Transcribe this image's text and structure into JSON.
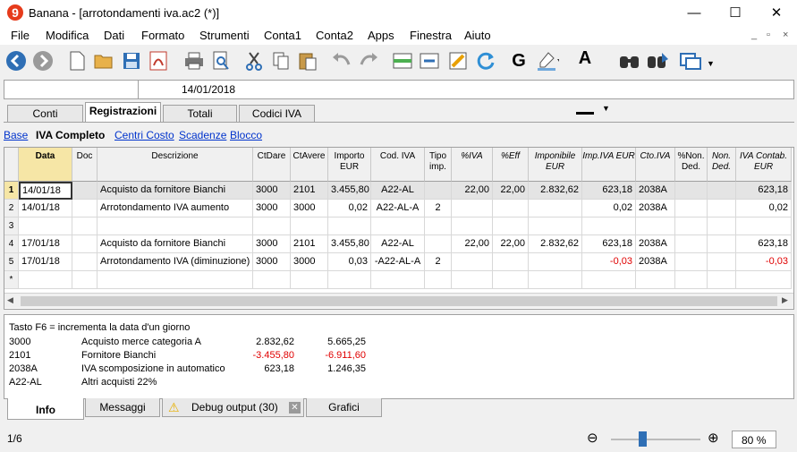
{
  "window": {
    "title": "Banana - [arrotondamenti iva.ac2 (*)]",
    "app_icon": "9",
    "minimize": "—",
    "maximize": "☐",
    "close": "✕"
  },
  "menu": [
    "File",
    "Modifica",
    "Dati",
    "Formato",
    "Strumenti",
    "Conta1",
    "Conta2",
    "Apps",
    "Finestra",
    "Aiuto"
  ],
  "mdi_controls": [
    "_",
    "▫",
    "×"
  ],
  "toolbar": {
    "icons": [
      "back-icon",
      "forward-icon",
      "new-file-icon",
      "open-folder-icon",
      "save-icon",
      "pdf-icon",
      "print-icon",
      "print-preview-icon",
      "cut-icon",
      "copy-icon",
      "paste-icon",
      "undo-icon",
      "redo-icon",
      "insert-rows-icon",
      "delete-rows-icon",
      "edit-icon",
      "recalculate-icon",
      "bold-icon",
      "highlight-icon",
      "font-color-icon",
      "find-icon",
      "find-next-icon",
      "window-icon"
    ],
    "bold_label": "G",
    "font_color_label": "A"
  },
  "cellbar": {
    "value": "14/01/2018"
  },
  "tabs": [
    "Conti",
    "Registrazioni",
    "Totali",
    "Codici IVA"
  ],
  "active_tab": "Registrazioni",
  "views": [
    "Base",
    "IVA Completo",
    "Centri Costo",
    "Scadenze",
    "Blocco"
  ],
  "active_view": "IVA Completo",
  "columns": [
    {
      "label": "Data"
    },
    {
      "label": "Doc"
    },
    {
      "label": "Descrizione"
    },
    {
      "label": "CtDare"
    },
    {
      "label": "CtAvere"
    },
    {
      "label": "Importo EUR"
    },
    {
      "label": "Cod. IVA"
    },
    {
      "label": "Tipo imp."
    },
    {
      "label": "%IVA"
    },
    {
      "label": "%Eff"
    },
    {
      "label": "Imponibile EUR"
    },
    {
      "label": "Imp.IVA EUR"
    },
    {
      "label": "Cto.IVA"
    },
    {
      "label": "%Non. Ded."
    },
    {
      "label": "Non. Ded."
    },
    {
      "label": "IVA Contab. EUR"
    }
  ],
  "rows": [
    {
      "n": "1",
      "data": "14/01/18",
      "doc": "",
      "desc": "Acquisto da fornitore Bianchi",
      "dare": "3000",
      "avere": "2101",
      "importo": "3.455,80",
      "codiva": "A22-AL",
      "tipo": "",
      "iva": "22,00",
      "eff": "22,00",
      "imponibile": "2.832,62",
      "impiva": "623,18",
      "ctoiva": "2038A",
      "pnd": "",
      "nd": "",
      "contab": "623,18"
    },
    {
      "n": "2",
      "data": "14/01/18",
      "doc": "",
      "desc": "Arrotondamento IVA aumento",
      "dare": "3000",
      "avere": "3000",
      "importo": "0,02",
      "codiva": "A22-AL-A",
      "tipo": "2",
      "iva": "",
      "eff": "",
      "imponibile": "",
      "impiva": "0,02",
      "ctoiva": "2038A",
      "pnd": "",
      "nd": "",
      "contab": "0,02"
    },
    {
      "n": "3",
      "data": "",
      "doc": "",
      "desc": "",
      "dare": "",
      "avere": "",
      "importo": "",
      "codiva": "",
      "tipo": "",
      "iva": "",
      "eff": "",
      "imponibile": "",
      "impiva": "",
      "ctoiva": "",
      "pnd": "",
      "nd": "",
      "contab": ""
    },
    {
      "n": "4",
      "data": "17/01/18",
      "doc": "",
      "desc": "Acquisto da fornitore Bianchi",
      "dare": "3000",
      "avere": "2101",
      "importo": "3.455,80",
      "codiva": "A22-AL",
      "tipo": "",
      "iva": "22,00",
      "eff": "22,00",
      "imponibile": "2.832,62",
      "impiva": "623,18",
      "ctoiva": "2038A",
      "pnd": "",
      "nd": "",
      "contab": "623,18"
    },
    {
      "n": "5",
      "data": "17/01/18",
      "doc": "",
      "desc": "Arrotondamento IVA (diminuzione)",
      "dare": "3000",
      "avere": "3000",
      "importo": "0,03",
      "codiva": "-A22-AL-A",
      "tipo": "2",
      "iva": "",
      "eff": "",
      "imponibile": "",
      "impiva": "-0,03",
      "ctoiva": "2038A",
      "pnd": "",
      "nd": "",
      "contab": "-0,03"
    },
    {
      "n": "*",
      "data": "",
      "doc": "",
      "desc": "",
      "dare": "",
      "avere": "",
      "importo": "",
      "codiva": "",
      "tipo": "",
      "iva": "",
      "eff": "",
      "imponibile": "",
      "impiva": "",
      "ctoiva": "",
      "pnd": "",
      "nd": "",
      "contab": ""
    }
  ],
  "info": {
    "hint": "Tasto F6 = incrementa la data d'un giorno",
    "lines": [
      {
        "code": "3000",
        "desc": "Acquisto merce categoria A",
        "v1": "2.832,62",
        "v2": "5.665,25"
      },
      {
        "code": "2101",
        "desc": "Fornitore Bianchi",
        "v1": "-3.455,80",
        "v2": "-6.911,60"
      },
      {
        "code": "2038A",
        "desc": "IVA scomposizione in automatico",
        "v1": "623,18",
        "v2": "1.246,35"
      },
      {
        "code": "A22-AL",
        "desc": "Altri acquisti 22%",
        "v1": "",
        "v2": ""
      }
    ]
  },
  "bottom_tabs": [
    "Info",
    "Messaggi",
    "Debug output (30)",
    "Grafici"
  ],
  "status": {
    "position": "1/6",
    "zoom": "80",
    "zoom_unit": "%",
    "zoom_level": 0.35
  },
  "colors": {
    "selected_row": "#f6e6a6",
    "negative": "#e00000",
    "link": "#0033cc"
  }
}
